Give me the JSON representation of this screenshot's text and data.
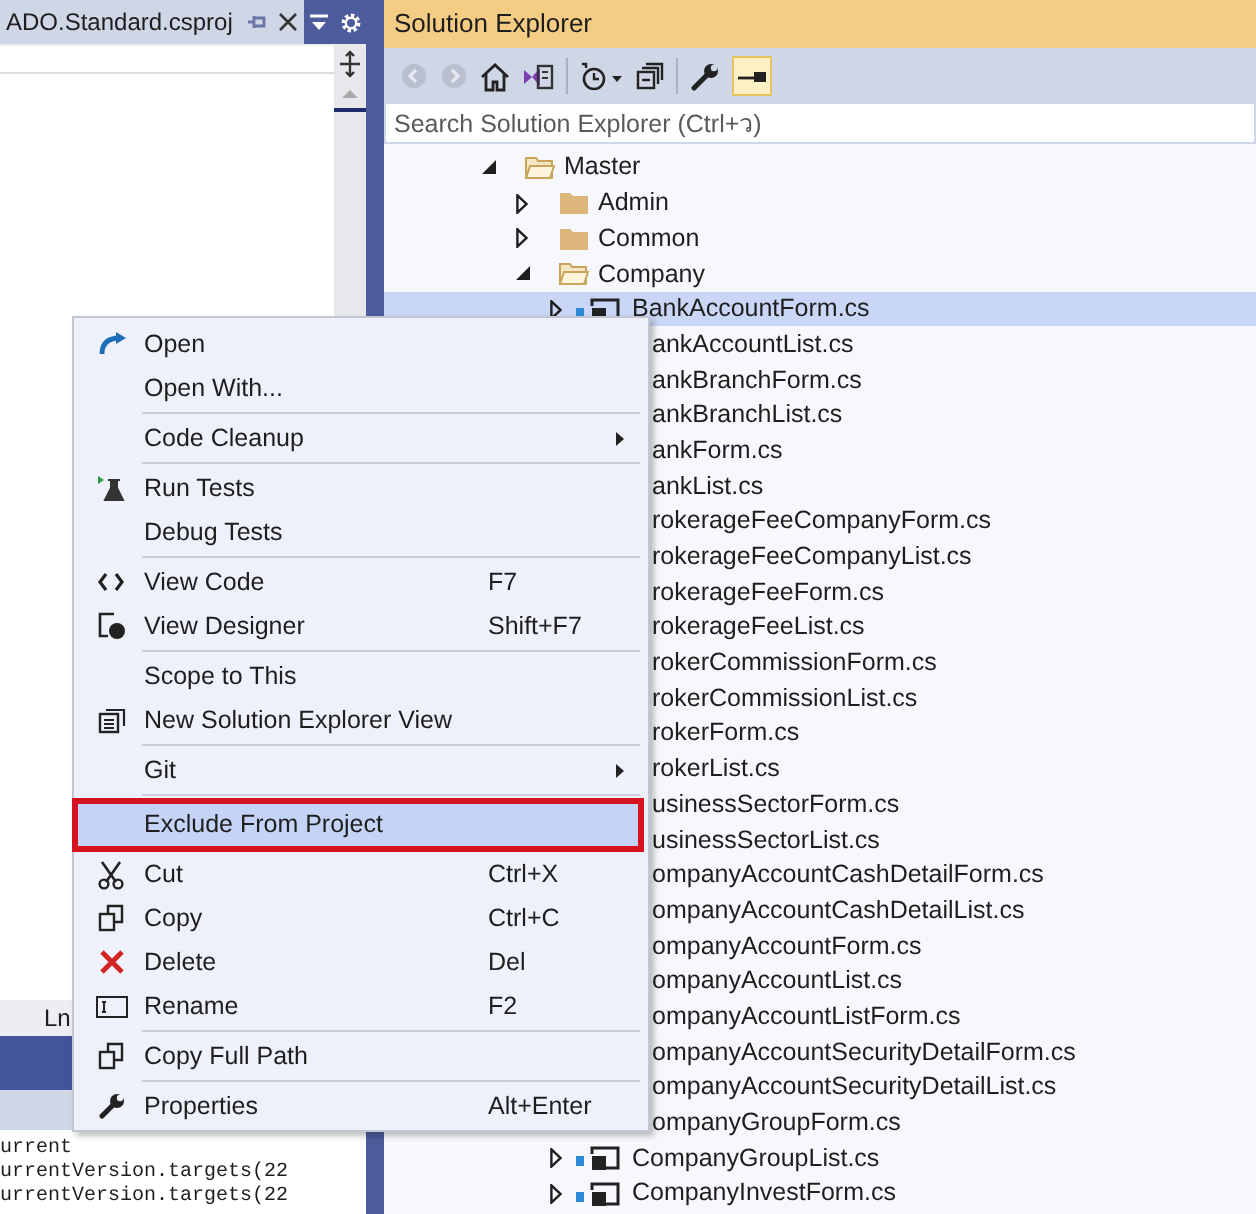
{
  "left_panel": {
    "tab": {
      "title": "ADO.Standard.csproj"
    },
    "status": "Ln",
    "output_lines": [
      "urrent",
      "urrentVersion.targets(22",
      "urrentVersion.targets(22"
    ]
  },
  "solution_explorer": {
    "title": "Solution Explorer",
    "search": {
      "placeholder": "Search Solution Explorer (Ctrl+ว)"
    },
    "tree": [
      {
        "label": "Master",
        "kind": "folder",
        "expanded": true,
        "selected": false,
        "children": [
          {
            "label": "Admin",
            "kind": "folder",
            "expanded": false,
            "selected": false
          },
          {
            "label": "Common",
            "kind": "folder",
            "expanded": false,
            "selected": false
          },
          {
            "label": "Company",
            "kind": "folder",
            "expanded": true,
            "selected": false,
            "children": [
              {
                "label": "BankAccountForm.cs",
                "kind": "file",
                "expanded": false,
                "selected": true
              },
              {
                "label": "ankAccountList.cs",
                "kind": "partial",
                "selected": false
              },
              {
                "label": "ankBranchForm.cs",
                "kind": "partial",
                "selected": false
              },
              {
                "label": "ankBranchList.cs",
                "kind": "partial",
                "selected": false
              },
              {
                "label": "ankForm.cs",
                "kind": "partial",
                "selected": false
              },
              {
                "label": "ankList.cs",
                "kind": "partial",
                "selected": false
              },
              {
                "label": "rokerageFeeCompanyForm.cs",
                "kind": "partial",
                "selected": false
              },
              {
                "label": "rokerageFeeCompanyList.cs",
                "kind": "partial",
                "selected": false
              },
              {
                "label": "rokerageFeeForm.cs",
                "kind": "partial",
                "selected": false
              },
              {
                "label": "rokerageFeeList.cs",
                "kind": "partial",
                "selected": false
              },
              {
                "label": "rokerCommissionForm.cs",
                "kind": "partial",
                "selected": false
              },
              {
                "label": "rokerCommissionList.cs",
                "kind": "partial",
                "selected": false
              },
              {
                "label": "rokerForm.cs",
                "kind": "partial",
                "selected": false
              },
              {
                "label": "rokerList.cs",
                "kind": "partial",
                "selected": false
              },
              {
                "label": "usinessSectorForm.cs",
                "kind": "partial",
                "selected": false
              },
              {
                "label": "usinessSectorList.cs",
                "kind": "partial",
                "selected": false
              },
              {
                "label": "ompanyAccountCashDetailForm.cs",
                "kind": "partial",
                "selected": false
              },
              {
                "label": "ompanyAccountCashDetailList.cs",
                "kind": "partial",
                "selected": false
              },
              {
                "label": "ompanyAccountForm.cs",
                "kind": "partial",
                "selected": false
              },
              {
                "label": "ompanyAccountList.cs",
                "kind": "partial",
                "selected": false
              },
              {
                "label": "ompanyAccountListForm.cs",
                "kind": "partial",
                "selected": false
              },
              {
                "label": "ompanyAccountSecurityDetailForm.cs",
                "kind": "partial",
                "selected": false
              },
              {
                "label": "ompanyAccountSecurityDetailList.cs",
                "kind": "partial",
                "selected": false
              },
              {
                "label": "ompanyGroupForm.cs",
                "kind": "partial",
                "selected": false
              },
              {
                "label": "CompanyGroupList.cs",
                "kind": "file",
                "expanded": false,
                "selected": false
              },
              {
                "label": "CompanyInvestForm.cs",
                "kind": "file",
                "expanded": false,
                "selected": false
              }
            ]
          }
        ]
      }
    ]
  },
  "context_menu": [
    {
      "kind": "item",
      "label": "Open",
      "selected": false
    },
    {
      "kind": "item",
      "label": "Open With...",
      "selected": false
    },
    {
      "kind": "separator"
    },
    {
      "kind": "item",
      "label": "Code Cleanup",
      "submenu": true,
      "selected": false
    },
    {
      "kind": "separator"
    },
    {
      "kind": "item",
      "label": "Run Tests",
      "selected": false
    },
    {
      "kind": "item",
      "label": "Debug Tests",
      "selected": false
    },
    {
      "kind": "separator"
    },
    {
      "kind": "item",
      "label": "View Code",
      "shortcut": "F7",
      "selected": false
    },
    {
      "kind": "item",
      "label": "View Designer",
      "shortcut": "Shift+F7",
      "selected": false
    },
    {
      "kind": "separator"
    },
    {
      "kind": "item",
      "label": "Scope to This",
      "selected": false
    },
    {
      "kind": "item",
      "label": "New Solution Explorer View",
      "selected": false
    },
    {
      "kind": "separator"
    },
    {
      "kind": "item",
      "label": "Git",
      "submenu": true,
      "selected": false
    },
    {
      "kind": "separator"
    },
    {
      "kind": "item",
      "label": "Exclude From Project",
      "selected": true
    },
    {
      "kind": "item",
      "label": "Cut",
      "shortcut": "Ctrl+X",
      "selected": false
    },
    {
      "kind": "item",
      "label": "Copy",
      "shortcut": "Ctrl+C",
      "selected": false
    },
    {
      "kind": "item",
      "label": "Delete",
      "shortcut": "Del",
      "selected": false
    },
    {
      "kind": "item",
      "label": "Rename",
      "shortcut": "F2",
      "selected": false
    },
    {
      "kind": "separator"
    },
    {
      "kind": "item",
      "label": "Copy Full Path",
      "selected": false
    },
    {
      "kind": "separator"
    },
    {
      "kind": "item",
      "label": "Properties",
      "shortcut": "Alt+Enter",
      "selected": false
    }
  ]
}
